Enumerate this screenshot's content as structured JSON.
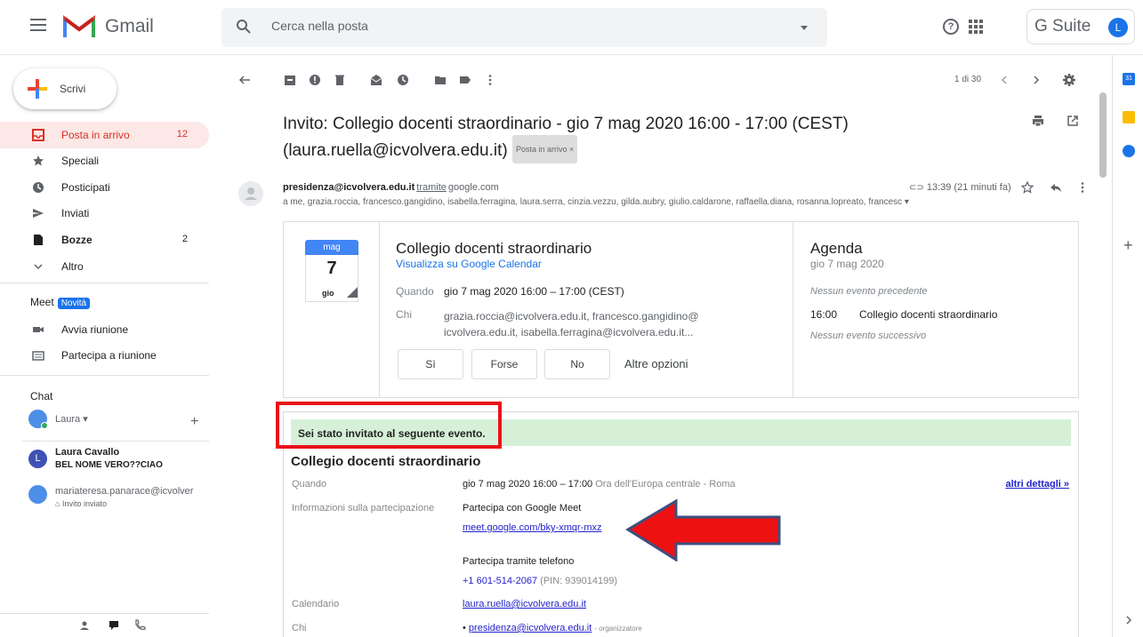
{
  "app": {
    "name": "Gmail"
  },
  "search": {
    "placeholder": "Cerca nella posta"
  },
  "header": {
    "suite_label": "G Suite",
    "avatar_letter": "L"
  },
  "compose": {
    "label": "Scrivi"
  },
  "nav": [
    {
      "label": "Posta in arrivo",
      "count": "12",
      "icon": "inbox-icon"
    },
    {
      "label": "Speciali",
      "count": "",
      "icon": "star-icon"
    },
    {
      "label": "Posticipati",
      "count": "",
      "icon": "clock-icon"
    },
    {
      "label": "Inviati",
      "count": "",
      "icon": "send-icon"
    },
    {
      "label": "Bozze",
      "count": "2",
      "icon": "draft-icon"
    },
    {
      "label": "Altro",
      "count": "",
      "icon": "chevron-down-icon"
    }
  ],
  "meet": {
    "title": "Meet",
    "badge": "Novità",
    "items": [
      {
        "label": "Avvia riunione",
        "icon": "video-icon"
      },
      {
        "label": "Partecipa a riunione",
        "icon": "keyboard-icon"
      }
    ]
  },
  "chat": {
    "title": "Chat",
    "me": "Laura",
    "contacts": [
      {
        "initial": "L",
        "name": "Laura Cavallo",
        "sub": "BEL NOME VERO??CIAO"
      },
      {
        "initial": "",
        "name": "mariateresa.panarace@icvolver",
        "sub": "Invito inviato"
      }
    ]
  },
  "toolbar": {
    "pager": "1 di 30"
  },
  "email": {
    "subject_line1": "Invito: Collegio docenti straordinario - gio 7 mag 2020 16:00 - 17:00 (CEST)",
    "subject_line2": "(laura.ruella@icvolvera.edu.it)",
    "label_chip": "Posta in arrivo ×",
    "sender": "presidenza@icvolvera.edu.it",
    "via": "tramite",
    "via_domain": "google.com",
    "time": "13:39 (21 minuti fa)",
    "recipients": "a me, grazia.roccia, francesco.gangidino, isabella.ferragina, laura.serra, cinzia.vezzu, gilda.aubry, giulio.caldarone, raffaella.diana, rosanna.lopreato, francesc ▾"
  },
  "invite_card": {
    "cal_month": "mag",
    "cal_day": "7",
    "cal_weekday": "gio",
    "title": "Collegio docenti straordinario",
    "calendar_link": "Visualizza su Google Calendar",
    "when_label": "Quando",
    "when_value": "gio 7 mag 2020 16:00 – 17:00 (CEST)",
    "who_label": "Chi",
    "who_value": "grazia.roccia@icvolvera.edu.it, francesco.gangidino@ icvolvera.edu.it, isabella.ferragina@icvolvera.edu.it...",
    "rsvp": [
      "Sì",
      "Forse",
      "No"
    ],
    "more_options": "Altre opzioni",
    "agenda_title": "Agenda",
    "agenda_date": "gio 7 mag 2020",
    "agenda_prev": "Nessun evento precedente",
    "agenda_time": "16:00",
    "agenda_event": "Collegio docenti straordinario",
    "agenda_next": "Nessun evento successivo"
  },
  "invite_detail": {
    "banner": "Sei stato invitato al seguente evento.",
    "title": "Collegio docenti straordinario",
    "when_label": "Quando",
    "when_value": "gio 7 mag 2020 16:00 – 17:00",
    "when_tz": "Ora dell'Europa centrale - Roma",
    "more_details": "altri dettagli »",
    "join_label": "Informazioni sulla partecipazione",
    "join_meet": "Partecipa con Google Meet",
    "meet_link": "meet.google.com/bky-xmqr-mxz",
    "join_phone": "Partecipa tramite telefono",
    "phone": "+1 601-514-2067",
    "pin": "(PIN: 939014199)",
    "calendar_label": "Calendario",
    "calendar_value": "laura.ruella@icvolvera.edu.it",
    "who_label": "Chi",
    "organizer": "presidenza@icvolvera.edu.it",
    "organizer_role": "- organizzatore"
  },
  "colors": {
    "accent_red": "#d93025",
    "annotation_red": "#e8131a",
    "banner_green": "#d6f0d8",
    "link_blue": "#1a73e8"
  }
}
